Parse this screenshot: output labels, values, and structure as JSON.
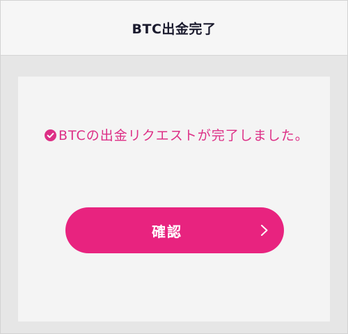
{
  "header": {
    "title": "BTC出金完了"
  },
  "message": {
    "text": "BTCの出金リクエストが完了しました。",
    "icon": "check-circle-icon",
    "color": "#dd2f86"
  },
  "confirm_button": {
    "label": "確認",
    "icon": "chevron-right-icon",
    "color": "#e8237f"
  }
}
